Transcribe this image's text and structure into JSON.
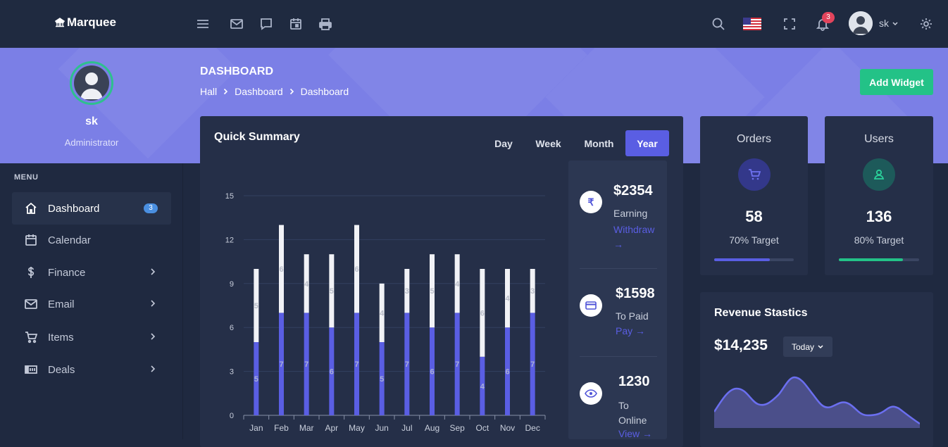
{
  "brand": {
    "name": "Marquee"
  },
  "topbar": {
    "notification_count": "3",
    "user_name": "sk"
  },
  "sidebar": {
    "profile_name": "sk",
    "profile_role": "Administrator",
    "menu_title": "MENU",
    "items": [
      {
        "label": "Dashboard",
        "icon": "home-icon",
        "badge": "3",
        "active": true
      },
      {
        "label": "Calendar",
        "icon": "calendar-icon"
      },
      {
        "label": "Finance",
        "icon": "dollar-icon"
      },
      {
        "label": "Email",
        "icon": "mail-icon"
      },
      {
        "label": "Items",
        "icon": "cart-icon"
      },
      {
        "label": "Deals",
        "icon": "deals-icon"
      }
    ]
  },
  "header": {
    "title": "DASHBOARD",
    "breadcrumb": [
      "Hall",
      "Dashboard",
      "Dashboard"
    ],
    "add_widget_label": "Add Widget"
  },
  "quick_summary": {
    "title": "Quick Summary",
    "tabs": [
      "Day",
      "Week",
      "Month",
      "Year"
    ],
    "active_tab": "Year",
    "stats": [
      {
        "value": "$2354",
        "label": "Earning",
        "link": "Withdraw →",
        "icon": "rupee-icon"
      },
      {
        "value": "$1598",
        "label": "To Paid",
        "link": "Pay →",
        "icon": "card-icon"
      },
      {
        "value": "1230",
        "label": "To Online",
        "link": "View →",
        "icon": "eye-icon"
      }
    ]
  },
  "chart_data": {
    "type": "bar",
    "stacked": true,
    "categories": [
      "Jan",
      "Feb",
      "Mar",
      "Apr",
      "May",
      "Jun",
      "Jul",
      "Aug",
      "Sep",
      "Oct",
      "Nov",
      "Dec"
    ],
    "series": [
      {
        "values": [
          5,
          7,
          7,
          6,
          7,
          5,
          7,
          6,
          7,
          4,
          6,
          7
        ],
        "color": "#5a5ee3"
      },
      {
        "values": [
          5,
          6,
          4,
          5,
          6,
          4,
          3,
          5,
          4,
          6,
          4,
          3
        ],
        "color": "#f1f2f6"
      }
    ],
    "ylim": [
      0,
      15
    ],
    "yticks": [
      0,
      3,
      6,
      9,
      12,
      15
    ],
    "grid": true
  },
  "orders": {
    "title": "Orders",
    "value": "58",
    "target": "70% Target",
    "progress": 0.7,
    "color": "#5a5ee3"
  },
  "users": {
    "title": "Users",
    "value": "136",
    "target": "80% Target",
    "progress": 0.8,
    "color": "#23c287"
  },
  "revenue": {
    "title": "Revenue Stastics",
    "value": "$14,235",
    "period": "Today"
  }
}
